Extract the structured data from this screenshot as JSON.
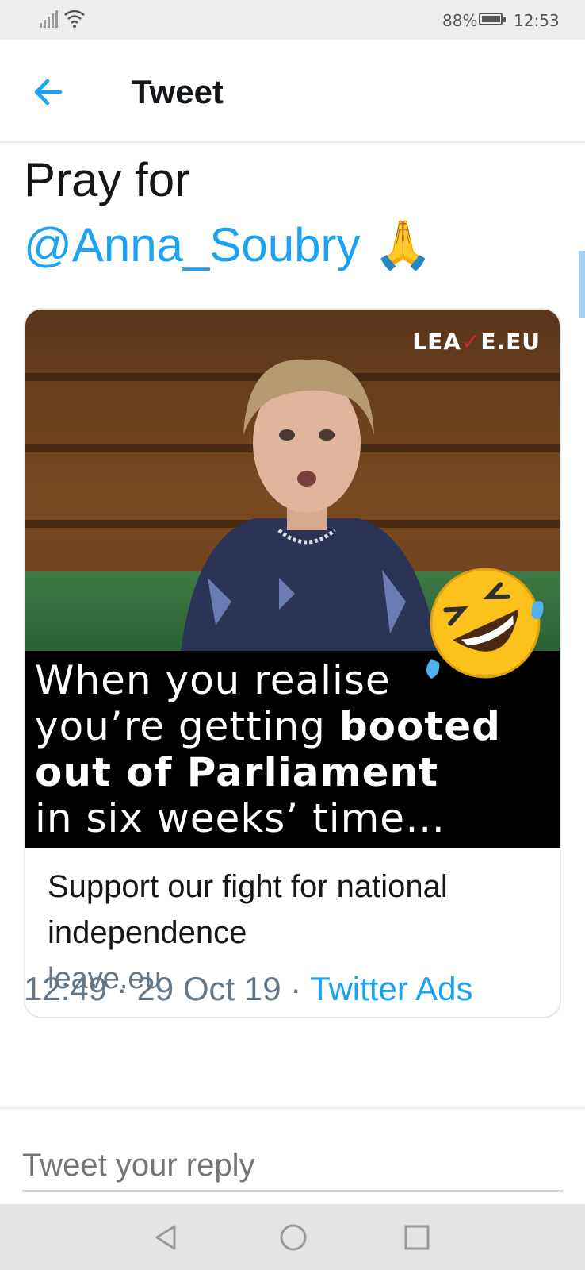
{
  "status_bar": {
    "battery_percent": "88%",
    "time": "12:53"
  },
  "header": {
    "title": "Tweet",
    "back_icon": "arrow-left-icon"
  },
  "tweet": {
    "text_line1": "Pray for",
    "mention": "@Anna_Soubry",
    "emoji": "🙏",
    "card": {
      "image": {
        "watermark_pre": "LEA",
        "watermark_tick": "✓",
        "watermark_post": "E.EU",
        "caption_line1": "When you realise",
        "caption_line2_pre": "you’re getting ",
        "caption_line2_bold": "booted",
        "caption_line3_bold": "out of Parliament",
        "caption_line4": "in six weeks’ time…",
        "emoji_icon": "rolling-on-floor-laughing-icon"
      },
      "title": "Support our fight for national independence",
      "domain": "leave.eu"
    },
    "time": "12:49",
    "separator": " · ",
    "date": "29 Oct 19",
    "source": "Twitter Ads"
  },
  "reply": {
    "placeholder": "Tweet your reply"
  },
  "nav": {
    "back_icon": "nav-back-triangle-icon",
    "home_icon": "nav-home-circle-icon",
    "recents_icon": "nav-recents-square-icon"
  },
  "colors": {
    "accent": "#1da1f2",
    "secondary_text": "#657786",
    "caption_bg": "#000000"
  }
}
